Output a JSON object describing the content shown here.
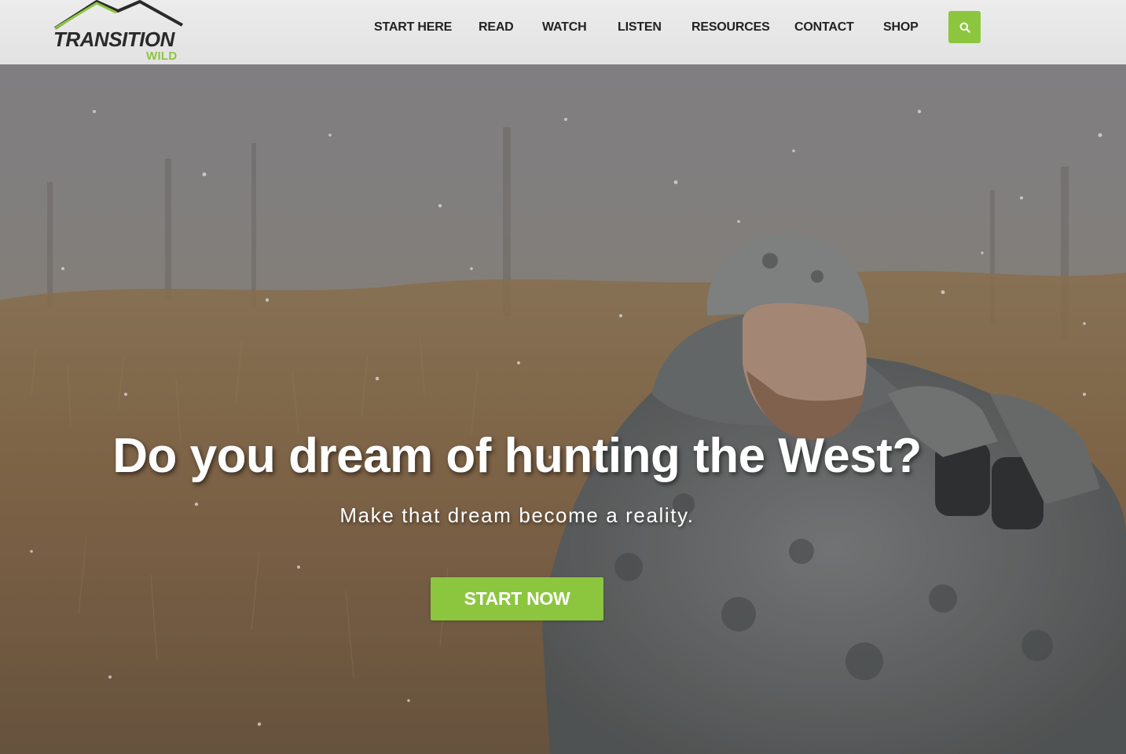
{
  "brand": {
    "name": "TRANSITION",
    "tagline": "WILD",
    "accent_color": "#8cc63f",
    "text_color": "#2a2a2a"
  },
  "nav": {
    "items": [
      {
        "label": "START HERE"
      },
      {
        "label": "READ"
      },
      {
        "label": "WATCH"
      },
      {
        "label": "LISTEN"
      },
      {
        "label": "RESOURCES"
      },
      {
        "label": "CONTACT"
      },
      {
        "label": "SHOP"
      }
    ],
    "search_icon": "search-icon"
  },
  "hero": {
    "headline": "Do you dream of hunting the West?",
    "subheadline": "Make that dream become a reality.",
    "cta_label": "START NOW",
    "image": "hunter-in-camo-with-binoculars-snowy-field"
  }
}
